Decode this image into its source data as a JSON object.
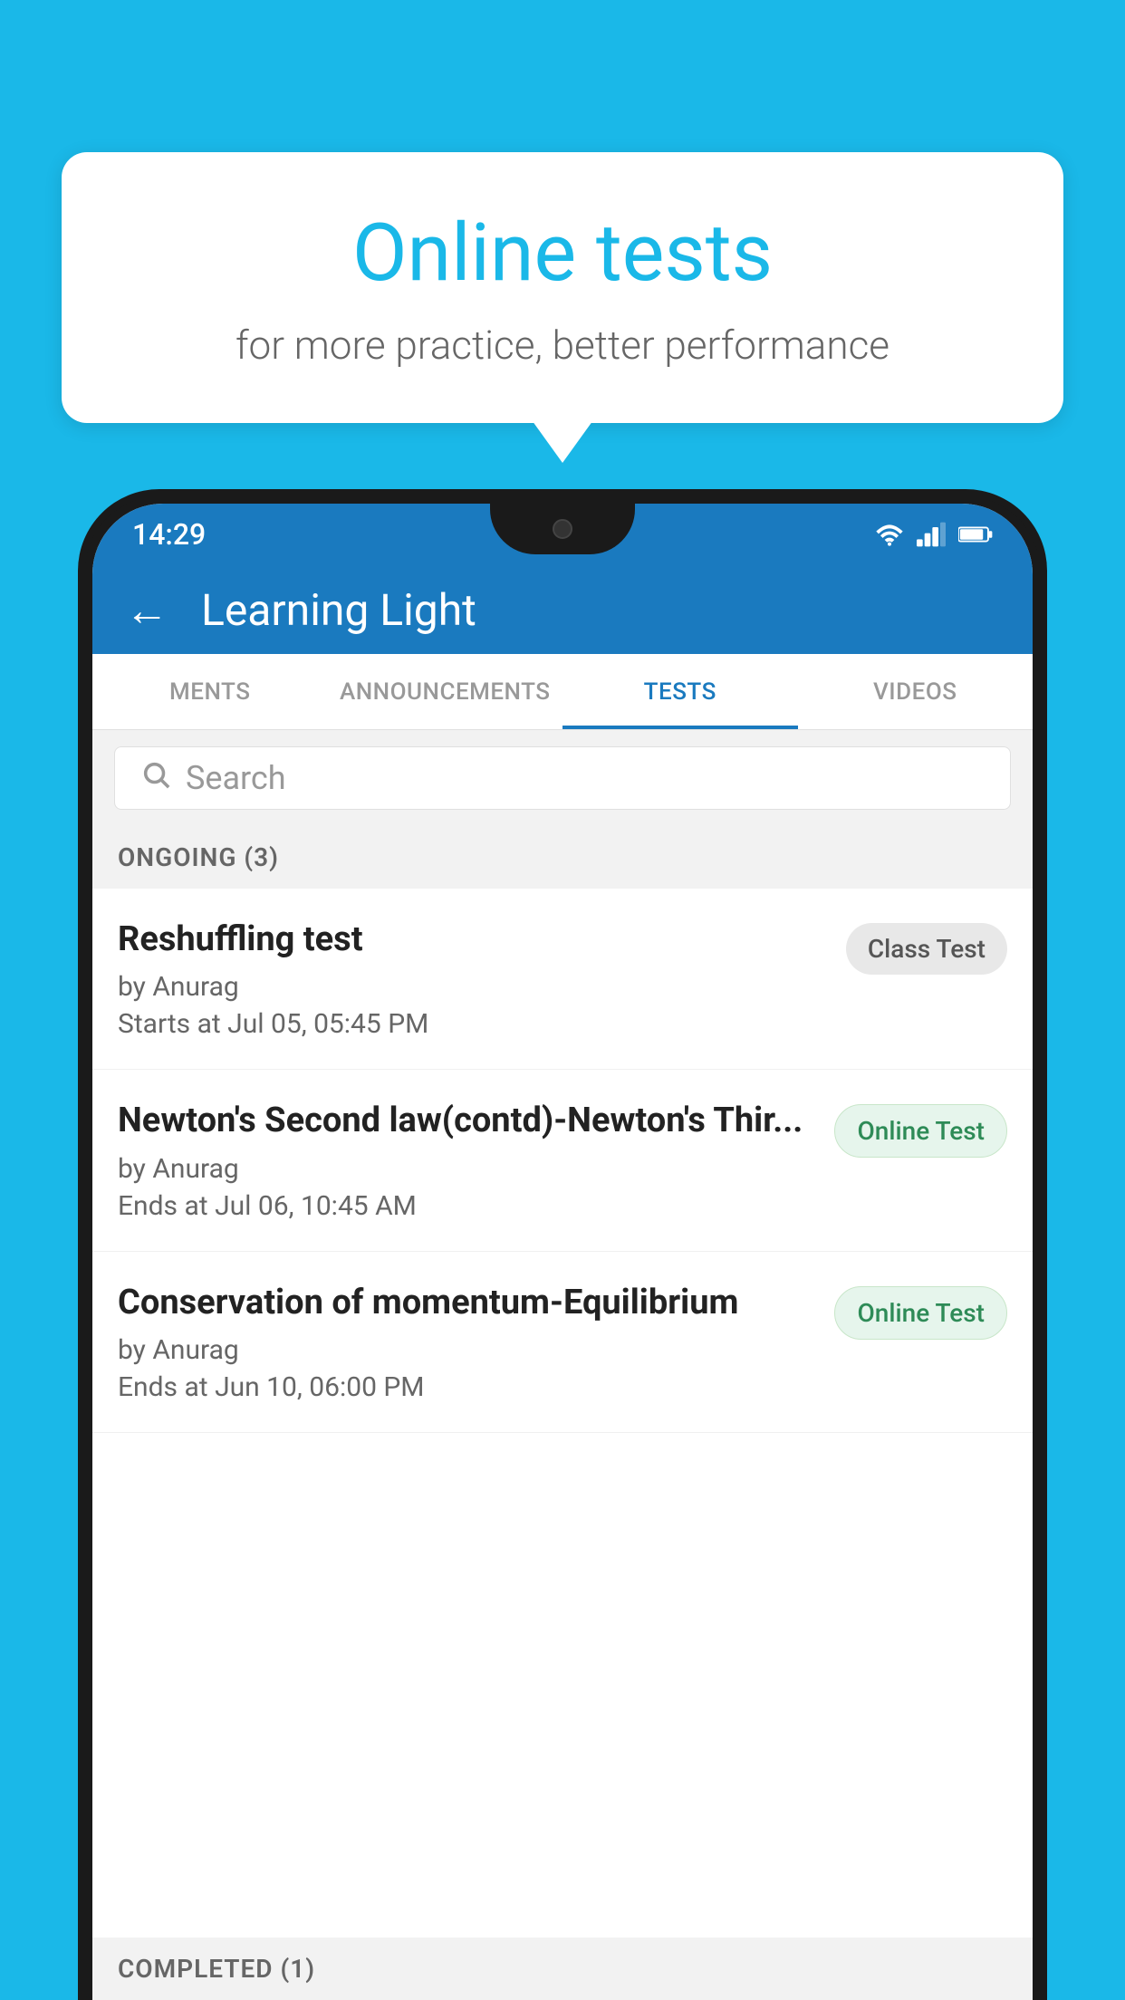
{
  "background": {
    "color": "#1ab8e8"
  },
  "speech_bubble": {
    "title": "Online tests",
    "subtitle": "for more practice, better performance"
  },
  "phone": {
    "status_bar": {
      "time": "14:29",
      "icons": [
        "wifi",
        "signal",
        "battery"
      ]
    },
    "app_bar": {
      "title": "Learning Light",
      "back_label": "←"
    },
    "tabs": [
      {
        "label": "MENTS",
        "active": false
      },
      {
        "label": "ANNOUNCEMENTS",
        "active": false
      },
      {
        "label": "TESTS",
        "active": true
      },
      {
        "label": "VIDEOS",
        "active": false
      }
    ],
    "search": {
      "placeholder": "Search"
    },
    "ongoing_section": {
      "header": "ONGOING (3)",
      "tests": [
        {
          "name": "Reshuffling test",
          "author": "by Anurag",
          "time_label": "Starts at",
          "time": "Jul 05, 05:45 PM",
          "badge": "Class Test",
          "badge_type": "class"
        },
        {
          "name": "Newton's Second law(contd)-Newton's Thir...",
          "author": "by Anurag",
          "time_label": "Ends at",
          "time": "Jul 06, 10:45 AM",
          "badge": "Online Test",
          "badge_type": "online"
        },
        {
          "name": "Conservation of momentum-Equilibrium",
          "author": "by Anurag",
          "time_label": "Ends at",
          "time": "Jun 10, 06:00 PM",
          "badge": "Online Test",
          "badge_type": "online"
        }
      ]
    },
    "completed_section": {
      "header": "COMPLETED (1)"
    }
  }
}
